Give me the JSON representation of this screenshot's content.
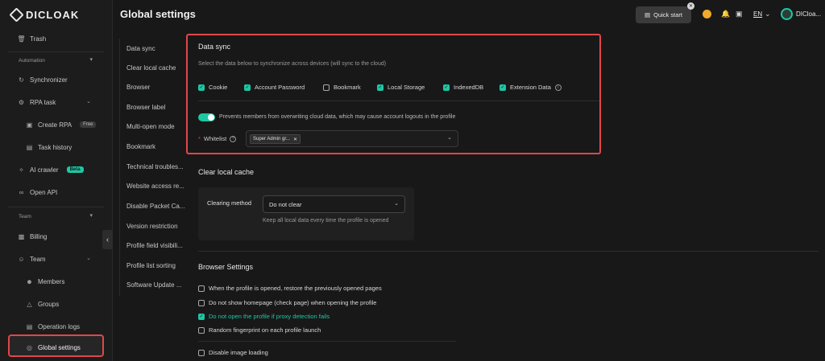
{
  "app": {
    "logo_text": "DICLOAK",
    "page_title": "Global settings"
  },
  "header": {
    "quick_start": "Quick start",
    "language": "EN",
    "user_name": "DICloa...",
    "icons": [
      "coin-icon",
      "bell-icon",
      "book-icon",
      "chevron-down-icon"
    ]
  },
  "sidebar": {
    "trash": "Trash",
    "section_automation": "Automation",
    "synchronizer": "Synchronizer",
    "rpa_task": "RPA task",
    "create_rpa": "Create RPA",
    "create_rpa_badge": "Free",
    "task_history": "Task history",
    "ai_crawler": "AI crawler",
    "ai_crawler_badge": "Beta",
    "open_api": "Open API",
    "section_team": "Team",
    "billing": "Billing",
    "team": "Team",
    "members": "Members",
    "groups": "Groups",
    "operation_logs": "Operation logs",
    "global_settings": "Global settings"
  },
  "settings_nav": [
    "Data sync",
    "Clear local cache",
    "Browser",
    "Browser label",
    "Multi-open mode",
    "Bookmark",
    "Technical troubles...",
    "Website access re...",
    "Disable Packet Ca...",
    "Version restriction",
    "Profile field visibili...",
    "Profile list sorting",
    "Software Update ..."
  ],
  "data_sync": {
    "title": "Data sync",
    "description": "Select the data below to synchronize across devices (will sync to the cloud)",
    "options": [
      {
        "label": "Cookie",
        "checked": true
      },
      {
        "label": "Account Password",
        "checked": true
      },
      {
        "label": "Bookmark",
        "checked": false
      },
      {
        "label": "Local Storage",
        "checked": true
      },
      {
        "label": "IndexedDB",
        "checked": true
      },
      {
        "label": "Extension Data",
        "checked": true
      }
    ],
    "toggle_on": true,
    "toggle_text": "Prevents members from overwriting cloud data, which may cause account logouts in the profile",
    "whitelist_required": "*",
    "whitelist_label": "Whitelist",
    "whitelist_tag": "Super Admin gr..."
  },
  "clear_cache": {
    "title": "Clear local cache",
    "method_label": "Clearing method",
    "method_value": "Do not clear",
    "hint": "Keep all local data every time the profile is opened"
  },
  "browser_settings": {
    "title": "Browser Settings",
    "options": [
      {
        "label": "When the profile is opened, restore the previously opened pages",
        "checked": false
      },
      {
        "label": "Do not show homepage (check page) when opening the profile",
        "checked": false
      },
      {
        "label": "Do not open the profile if proxy detection fails",
        "checked": true
      },
      {
        "label": "Random fingerprint on each profile launch",
        "checked": false
      },
      {
        "label": "Disable image loading",
        "checked": false
      }
    ]
  },
  "colors": {
    "accent": "#1ec7a3",
    "highlight": "#e0464a",
    "background": "#181818",
    "coin": "#f0a92a"
  }
}
